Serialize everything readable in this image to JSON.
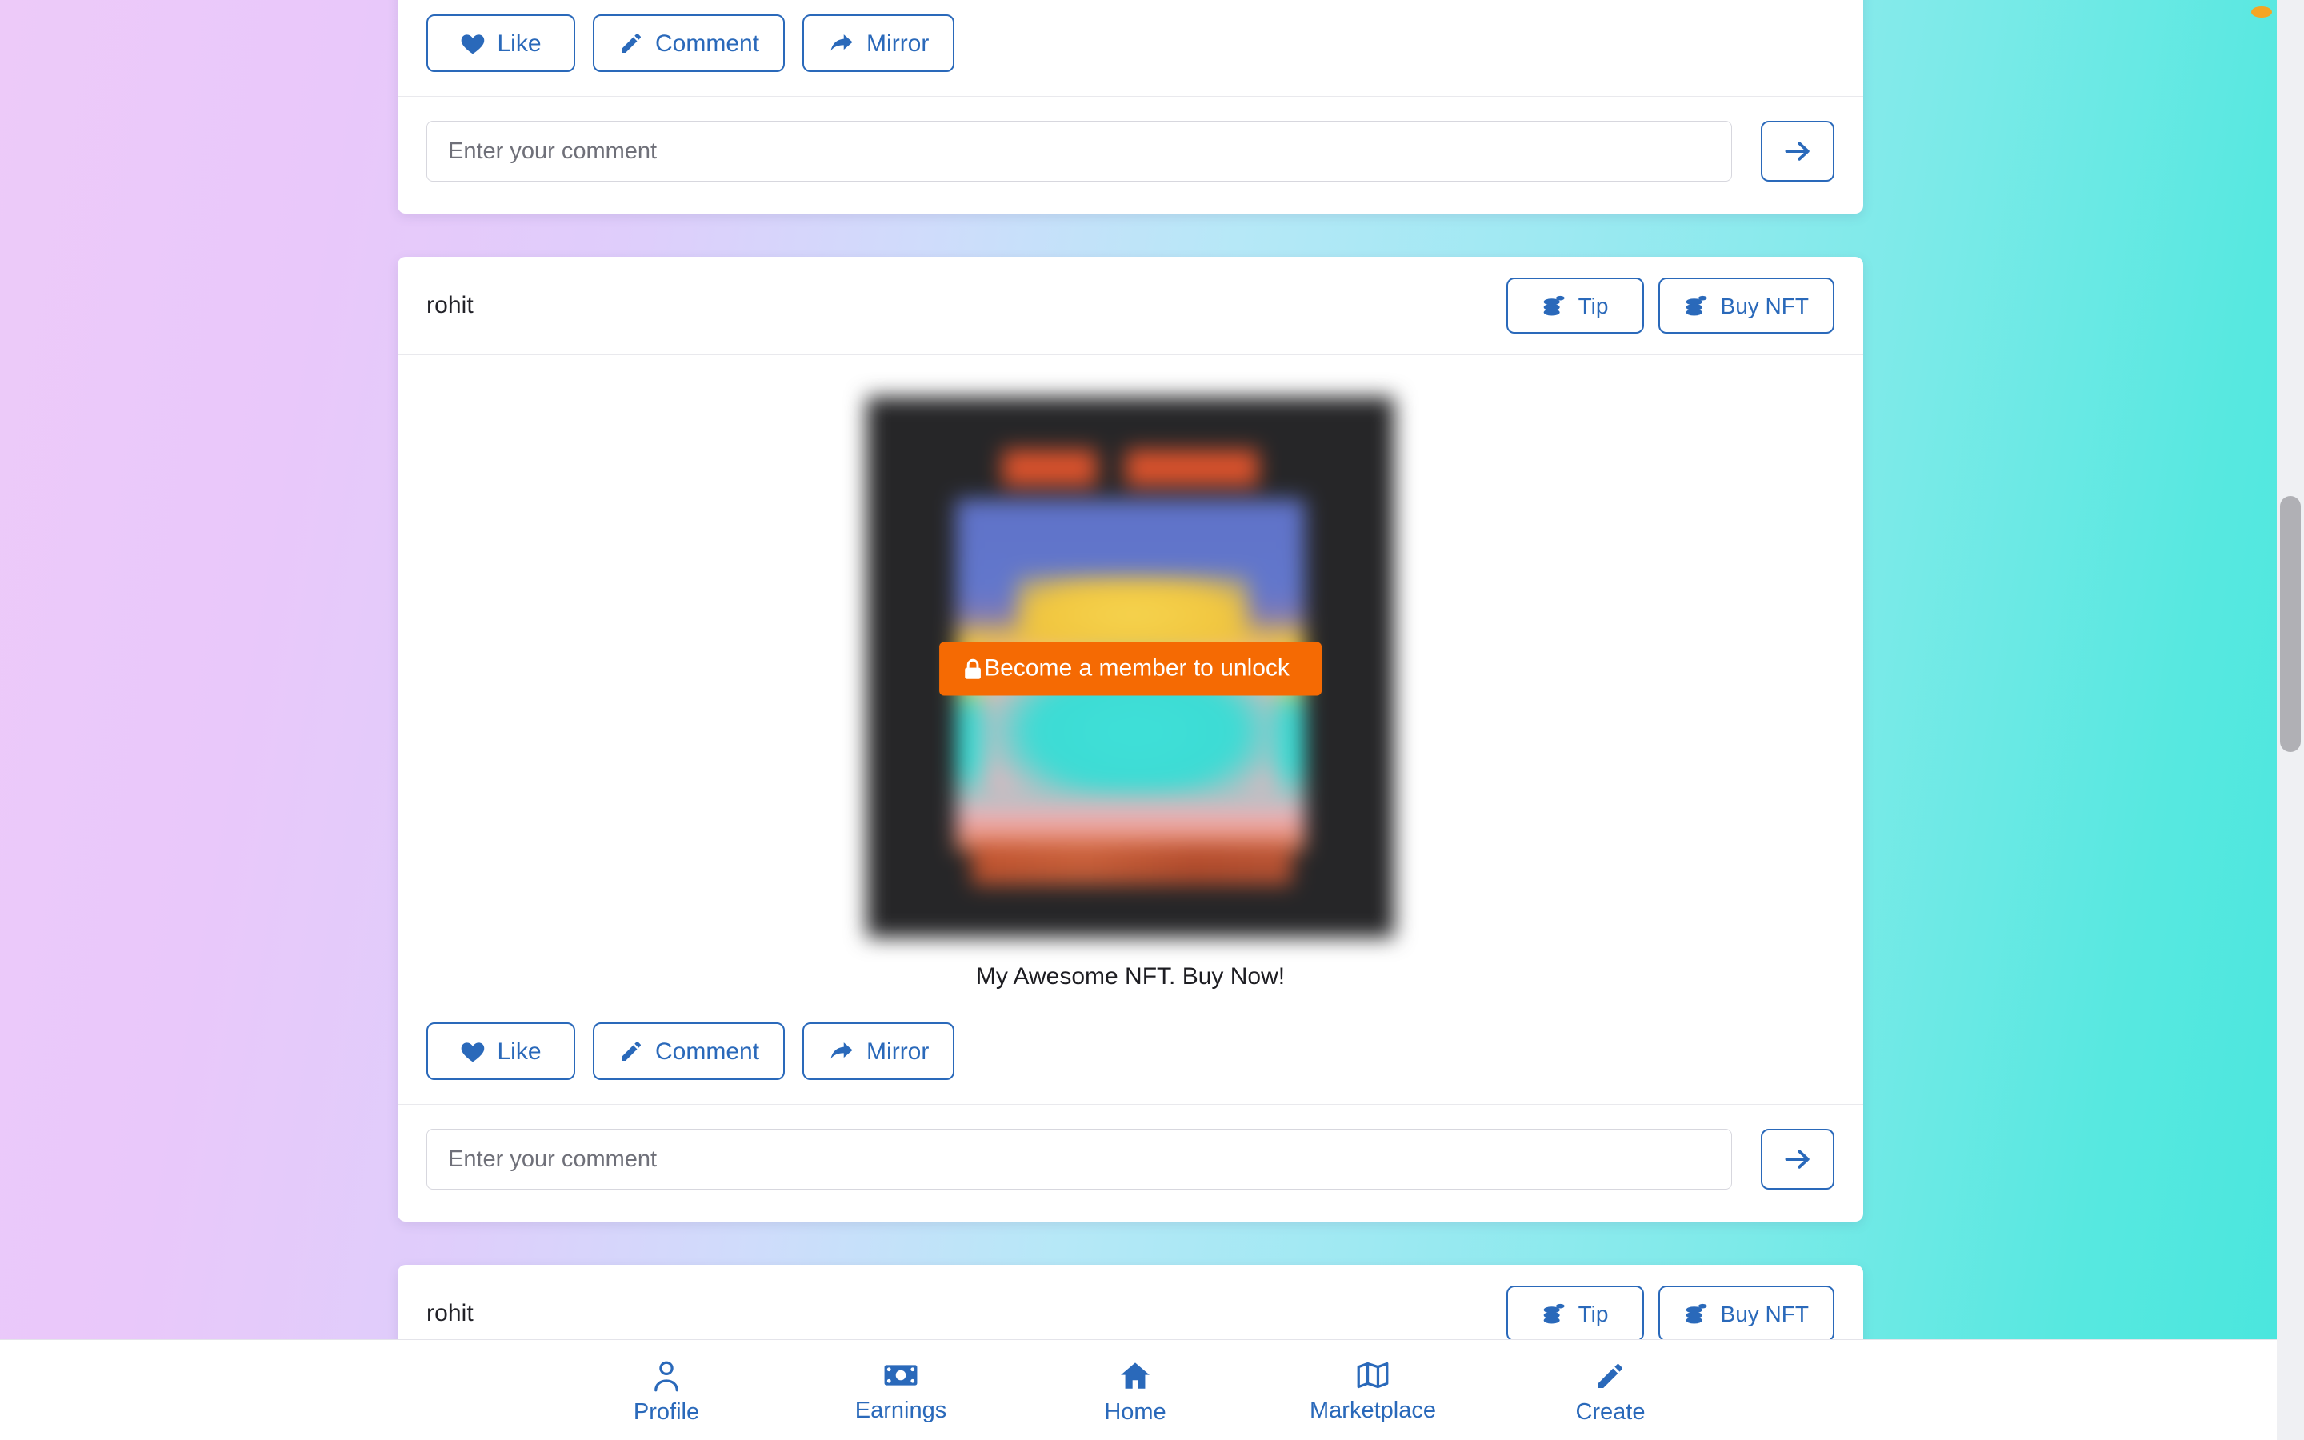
{
  "theme": {
    "accent_blue": "#2a69ba",
    "unlock_orange": "#f56a03",
    "bg_gradient_start": "#edcaf9",
    "bg_gradient_end": "#48e6dd",
    "card_bg": "#ffffff",
    "text_dark": "#1d1d22"
  },
  "posts": [
    {
      "actions": {
        "like_label": "Like",
        "comment_label": "Comment",
        "mirror_label": "Mirror"
      },
      "comment": {
        "placeholder": "Enter your comment",
        "value": "",
        "send_label": "→"
      }
    },
    {
      "username": "rohit",
      "header_actions": {
        "tip_label": "Tip",
        "buy_nft_label": "Buy NFT"
      },
      "media": {
        "unlock_label": "Become a member to unlock",
        "locked": true
      },
      "caption": "My Awesome NFT. Buy Now!",
      "actions": {
        "like_label": "Like",
        "comment_label": "Comment",
        "mirror_label": "Mirror"
      },
      "comment": {
        "placeholder": "Enter your comment",
        "value": "",
        "send_label": "→"
      }
    },
    {
      "username": "rohit",
      "header_actions": {
        "tip_label": "Tip",
        "buy_nft_label": "Buy NFT"
      }
    }
  ],
  "bottom_nav": {
    "items": [
      {
        "label": "Profile",
        "icon": "person-icon"
      },
      {
        "label": "Earnings",
        "icon": "banknote-icon"
      },
      {
        "label": "Home",
        "icon": "home-icon"
      },
      {
        "label": "Marketplace",
        "icon": "map-icon"
      },
      {
        "label": "Create",
        "icon": "pencil-icon"
      }
    ]
  }
}
